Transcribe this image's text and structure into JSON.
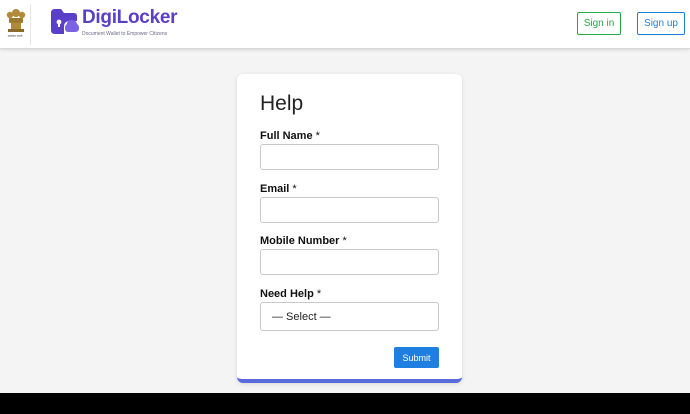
{
  "header": {
    "logo_title": "DigiLocker",
    "logo_tagline": "Document Wallet to Empower Citizens",
    "emblem_caption": "सत्यमेव जयते",
    "signin_label": "Sign in",
    "signup_label": "Sign up"
  },
  "form": {
    "title": "Help",
    "fields": [
      {
        "label": "Full Name",
        "required_mark": "*",
        "value": ""
      },
      {
        "label": "Email",
        "required_mark": "*",
        "value": ""
      },
      {
        "label": "Mobile Number",
        "required_mark": "*",
        "value": ""
      }
    ],
    "need_help": {
      "label": "Need Help",
      "required_mark": "*",
      "selected": "— Select —"
    },
    "submit_label": "Submit"
  },
  "colors": {
    "brand": "#5a3fc8",
    "signin": "#28a745",
    "signup": "#1f7fd6",
    "submit": "#1f7fe0",
    "card_accent": "#5b6bdc"
  }
}
